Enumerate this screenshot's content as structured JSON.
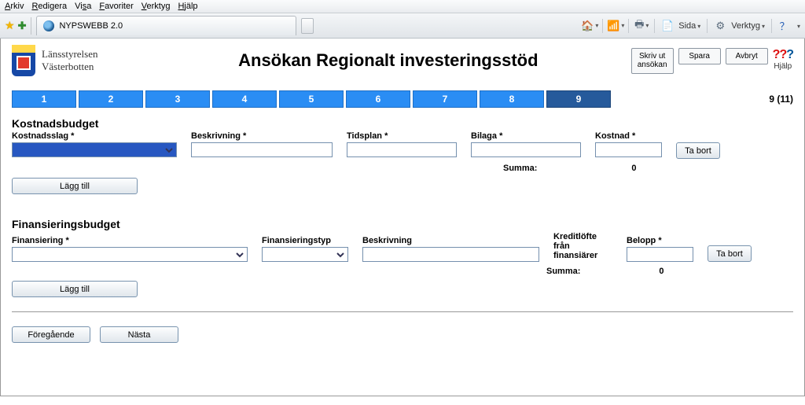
{
  "menubar": [
    "Arkiv",
    "Redigera",
    "Visa",
    "Favoriter",
    "Verktyg",
    "Hjälp"
  ],
  "browser": {
    "tab_title": "NYPSWEBB 2.0",
    "right": {
      "sida": "Sida",
      "verktyg": "Verktyg"
    }
  },
  "org": {
    "line1": "Länsstyrelsen",
    "line2": "Västerbotten"
  },
  "title": "Ansökan Regionalt investeringsstöd",
  "actions": {
    "print": "Skriv ut\nansökan",
    "save": "Spara",
    "cancel": "Avbryt",
    "help": "Hjälp"
  },
  "steps": {
    "labels": [
      "1",
      "2",
      "3",
      "4",
      "5",
      "6",
      "7",
      "8",
      "9"
    ],
    "current": 9,
    "counter": "9 (11)"
  },
  "kost": {
    "heading": "Kostnadsbudget",
    "labels": {
      "slag": "Kostnadsslag *",
      "beskrivning": "Beskrivning *",
      "tidsplan": "Tidsplan *",
      "bilaga": "Bilaga *",
      "kostnad": "Kostnad *"
    },
    "row": {
      "slag": "",
      "beskrivning": "",
      "tidsplan": "",
      "bilaga": "",
      "kostnad": ""
    },
    "ta_bort": "Ta bort",
    "summa_label": "Summa:",
    "summa_value": "0",
    "add": "Lägg till"
  },
  "fin": {
    "heading": "Finansieringsbudget",
    "labels": {
      "fin": "Finansiering *",
      "typ": "Finansieringstyp",
      "beskrivning": "Beskrivning",
      "kredit": "Kreditlöfte\nfrån\nfinansiärer",
      "belopp": "Belopp *"
    },
    "row": {
      "fin": "",
      "typ": "",
      "beskrivning": "",
      "belopp": ""
    },
    "ta_bort": "Ta bort",
    "summa_label": "Summa:",
    "summa_value": "0",
    "add": "Lägg till"
  },
  "nav": {
    "prev": "Föregående",
    "next": "Nästa"
  }
}
